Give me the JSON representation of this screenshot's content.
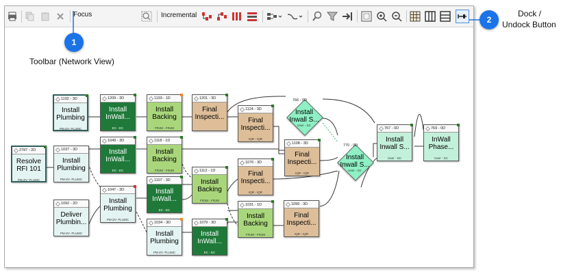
{
  "toolbar": {
    "focus_label": "Focus",
    "incremental_label": "Incremental"
  },
  "callouts": [
    {
      "number": "1",
      "label": "Toolbar (Network View)"
    },
    {
      "number": "2",
      "label_line1": "Dock /",
      "label_line2": "Undock Button"
    }
  ],
  "colors": {
    "callout": "#1a73e8",
    "critical_border": "#2f5f5c",
    "dark_task": "#1f7a3a"
  },
  "nodes": [
    {
      "id": "n1",
      "header": "1192 - 3D",
      "title1": "Install",
      "title2": "Plumbing",
      "sub": "PM-ZV- PLUMC"
    },
    {
      "id": "n2",
      "header": "1209 - 3D",
      "title1": "Install",
      "title2": "InWall...",
      "sub": "EC - EC"
    },
    {
      "id": "n3",
      "header": "1193 - 1D",
      "title1": "Install",
      "title2": "Backing",
      "sub": "FRJM - FRJM"
    },
    {
      "id": "n4",
      "header": "1201 - 3D",
      "title1": "Final",
      "title2": "Inspecti...",
      "sub": ""
    },
    {
      "id": "n5",
      "header": "1124 - 3D",
      "title1": "Final",
      "title2": "Inspecti...",
      "sub": "IQR - IQR"
    },
    {
      "id": "n6",
      "header": "766 - 0D",
      "title1": "Install",
      "title2": "Inwall S...",
      "sub": "User - SC"
    },
    {
      "id": "n7",
      "header": "2787 - 2D",
      "title1": "Resolve",
      "title2": "RFI 101",
      "sub": "PM-ZV- PLUMC"
    },
    {
      "id": "n8",
      "header": "1037 - 3D",
      "title1": "Install",
      "title2": "Plumbing",
      "sub": "PM-ZV- PLUMC"
    },
    {
      "id": "n9",
      "header": "1049 - 3D",
      "title1": "Install",
      "title2": "InWall...",
      "sub": "EC - EC"
    },
    {
      "id": "n10",
      "header": "1118 - 1D",
      "title1": "Install",
      "title2": "Backing",
      "sub": "FRJM - FRJM"
    },
    {
      "id": "n11",
      "header": "1108 - 3D",
      "title1": "Final",
      "title2": "Inspecti...",
      "sub": "IQR - IQR"
    },
    {
      "id": "n12",
      "header": "770 - 0D",
      "title1": "Install",
      "title2": "Inwall S...",
      "sub": "User - SC"
    },
    {
      "id": "n13",
      "header": "767 - 0D",
      "title1": "Install",
      "title2": "Inwall S...",
      "sub": "User - SC"
    },
    {
      "id": "n14",
      "header": "769 - 0D",
      "title1": "InWall",
      "title2": "Phase...",
      "sub": "User - SC"
    },
    {
      "id": "n15",
      "header": "1112 - 1D",
      "title1": "Install",
      "title2": "Backing",
      "sub": "FRJM - FRJM"
    },
    {
      "id": "n16",
      "header": "1076 - 3D",
      "title1": "Final",
      "title2": "Inspecti...",
      "sub": "IQR - IQR"
    },
    {
      "id": "n17",
      "header": "1047 - 3D",
      "title1": "Install",
      "title2": "Plumbing",
      "sub": "PM-ZV- PLUMC"
    },
    {
      "id": "n18",
      "header": "1107 - 3D",
      "title1": "Install",
      "title2": "InWall...",
      "sub": "EC - EC"
    },
    {
      "id": "n19",
      "header": "1092 - 2D",
      "title1": "Deliver",
      "title2": "Plumbin...",
      "sub": "PM-ZV- PLUMC"
    },
    {
      "id": "n20",
      "header": "1031 - 1D",
      "title1": "Install",
      "title2": "Backing",
      "sub": "FRJM - FRJM"
    },
    {
      "id": "n21",
      "header": "1099 - 3D",
      "title1": "Final",
      "title2": "Inspecti...",
      "sub": "IQR - IQR"
    },
    {
      "id": "n22",
      "header": "1034 - 3D",
      "title1": "Install",
      "title2": "Plumbing",
      "sub": "PM-ZV- PLUMC"
    },
    {
      "id": "n23",
      "header": "1079 - 3D",
      "title1": "Install",
      "title2": "InWall...",
      "sub": "EC - EC"
    }
  ]
}
